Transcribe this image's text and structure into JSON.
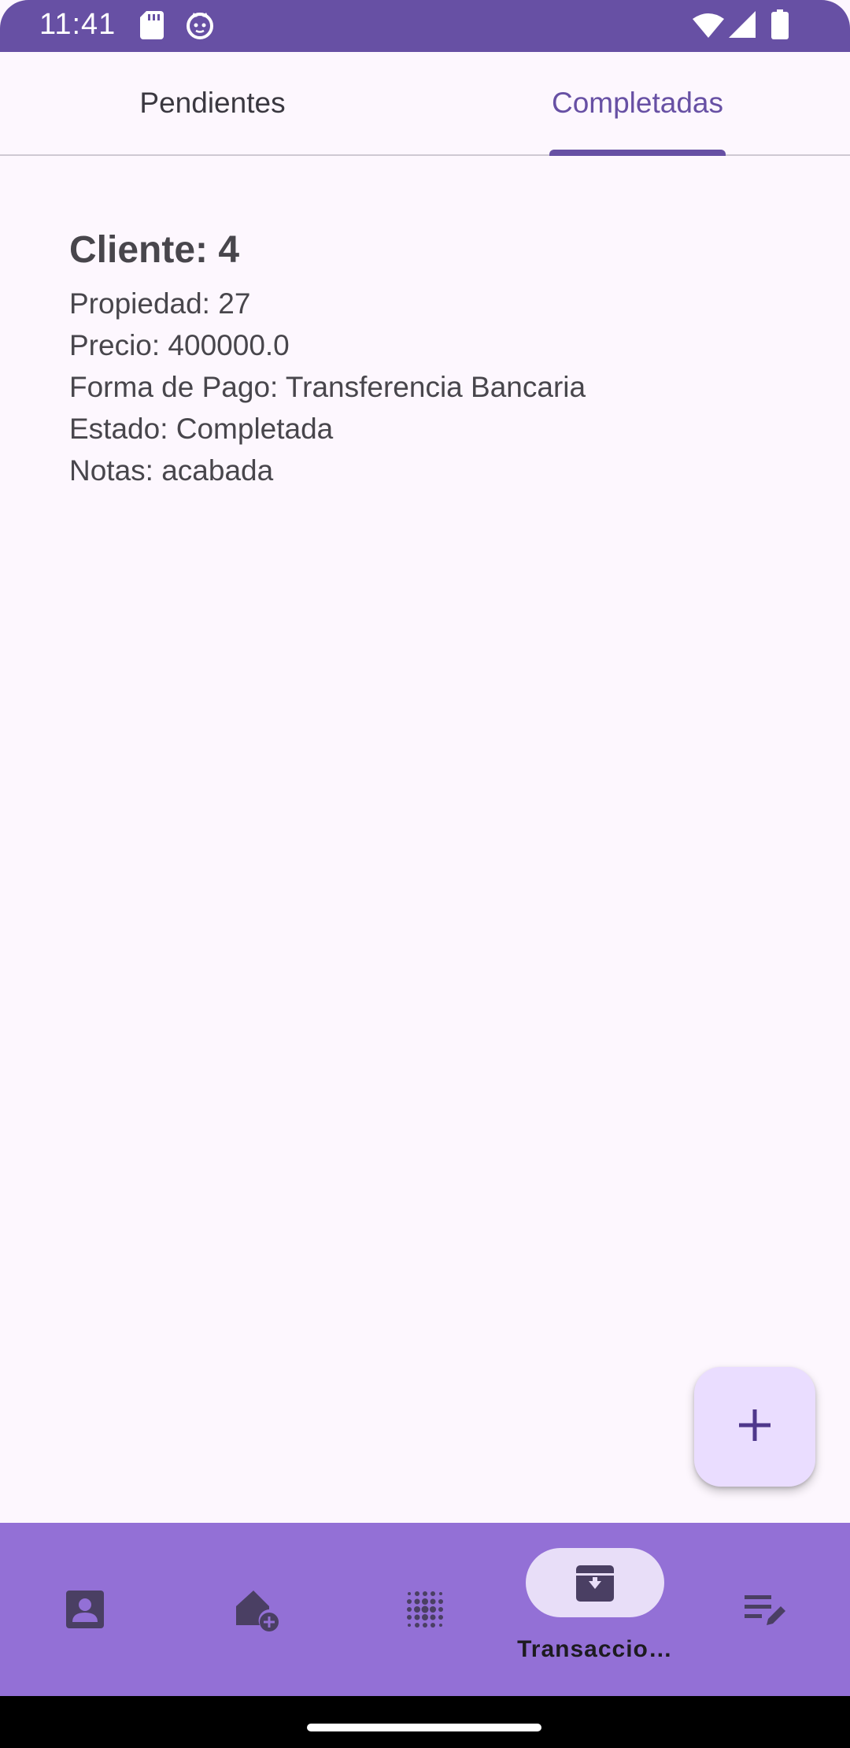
{
  "status_bar": {
    "time": "11:41",
    "icons": [
      "sd-card-icon",
      "cat-face-icon",
      "wifi-icon",
      "signal-icon",
      "battery-icon"
    ]
  },
  "tabs": [
    {
      "label": "Pendientes",
      "selected": false
    },
    {
      "label": "Completadas",
      "selected": true
    }
  ],
  "transaction": {
    "title": "Cliente: 4",
    "lines": [
      "Propiedad: 27",
      "Precio: 400000.0",
      "Forma de Pago: Transferencia Bancaria",
      "Estado: Completada",
      "Notas: acabada"
    ]
  },
  "fab": {
    "icon": "plus-icon"
  },
  "bottom_nav": {
    "items": [
      {
        "icon": "contact-card-icon",
        "label": "",
        "active": false
      },
      {
        "icon": "home-add-icon",
        "label": "",
        "active": false
      },
      {
        "icon": "dot-grid-icon",
        "label": "",
        "active": false
      },
      {
        "icon": "archive-icon",
        "label": "Transaccio…",
        "active": true
      },
      {
        "icon": "edit-notes-icon",
        "label": "",
        "active": false
      }
    ]
  },
  "colors": {
    "primary": "#6750A4",
    "background": "#FDF7FE",
    "nav_bar": "#9370D6",
    "fab": "#EADDFF",
    "active_pill": "#E8DEF8"
  }
}
